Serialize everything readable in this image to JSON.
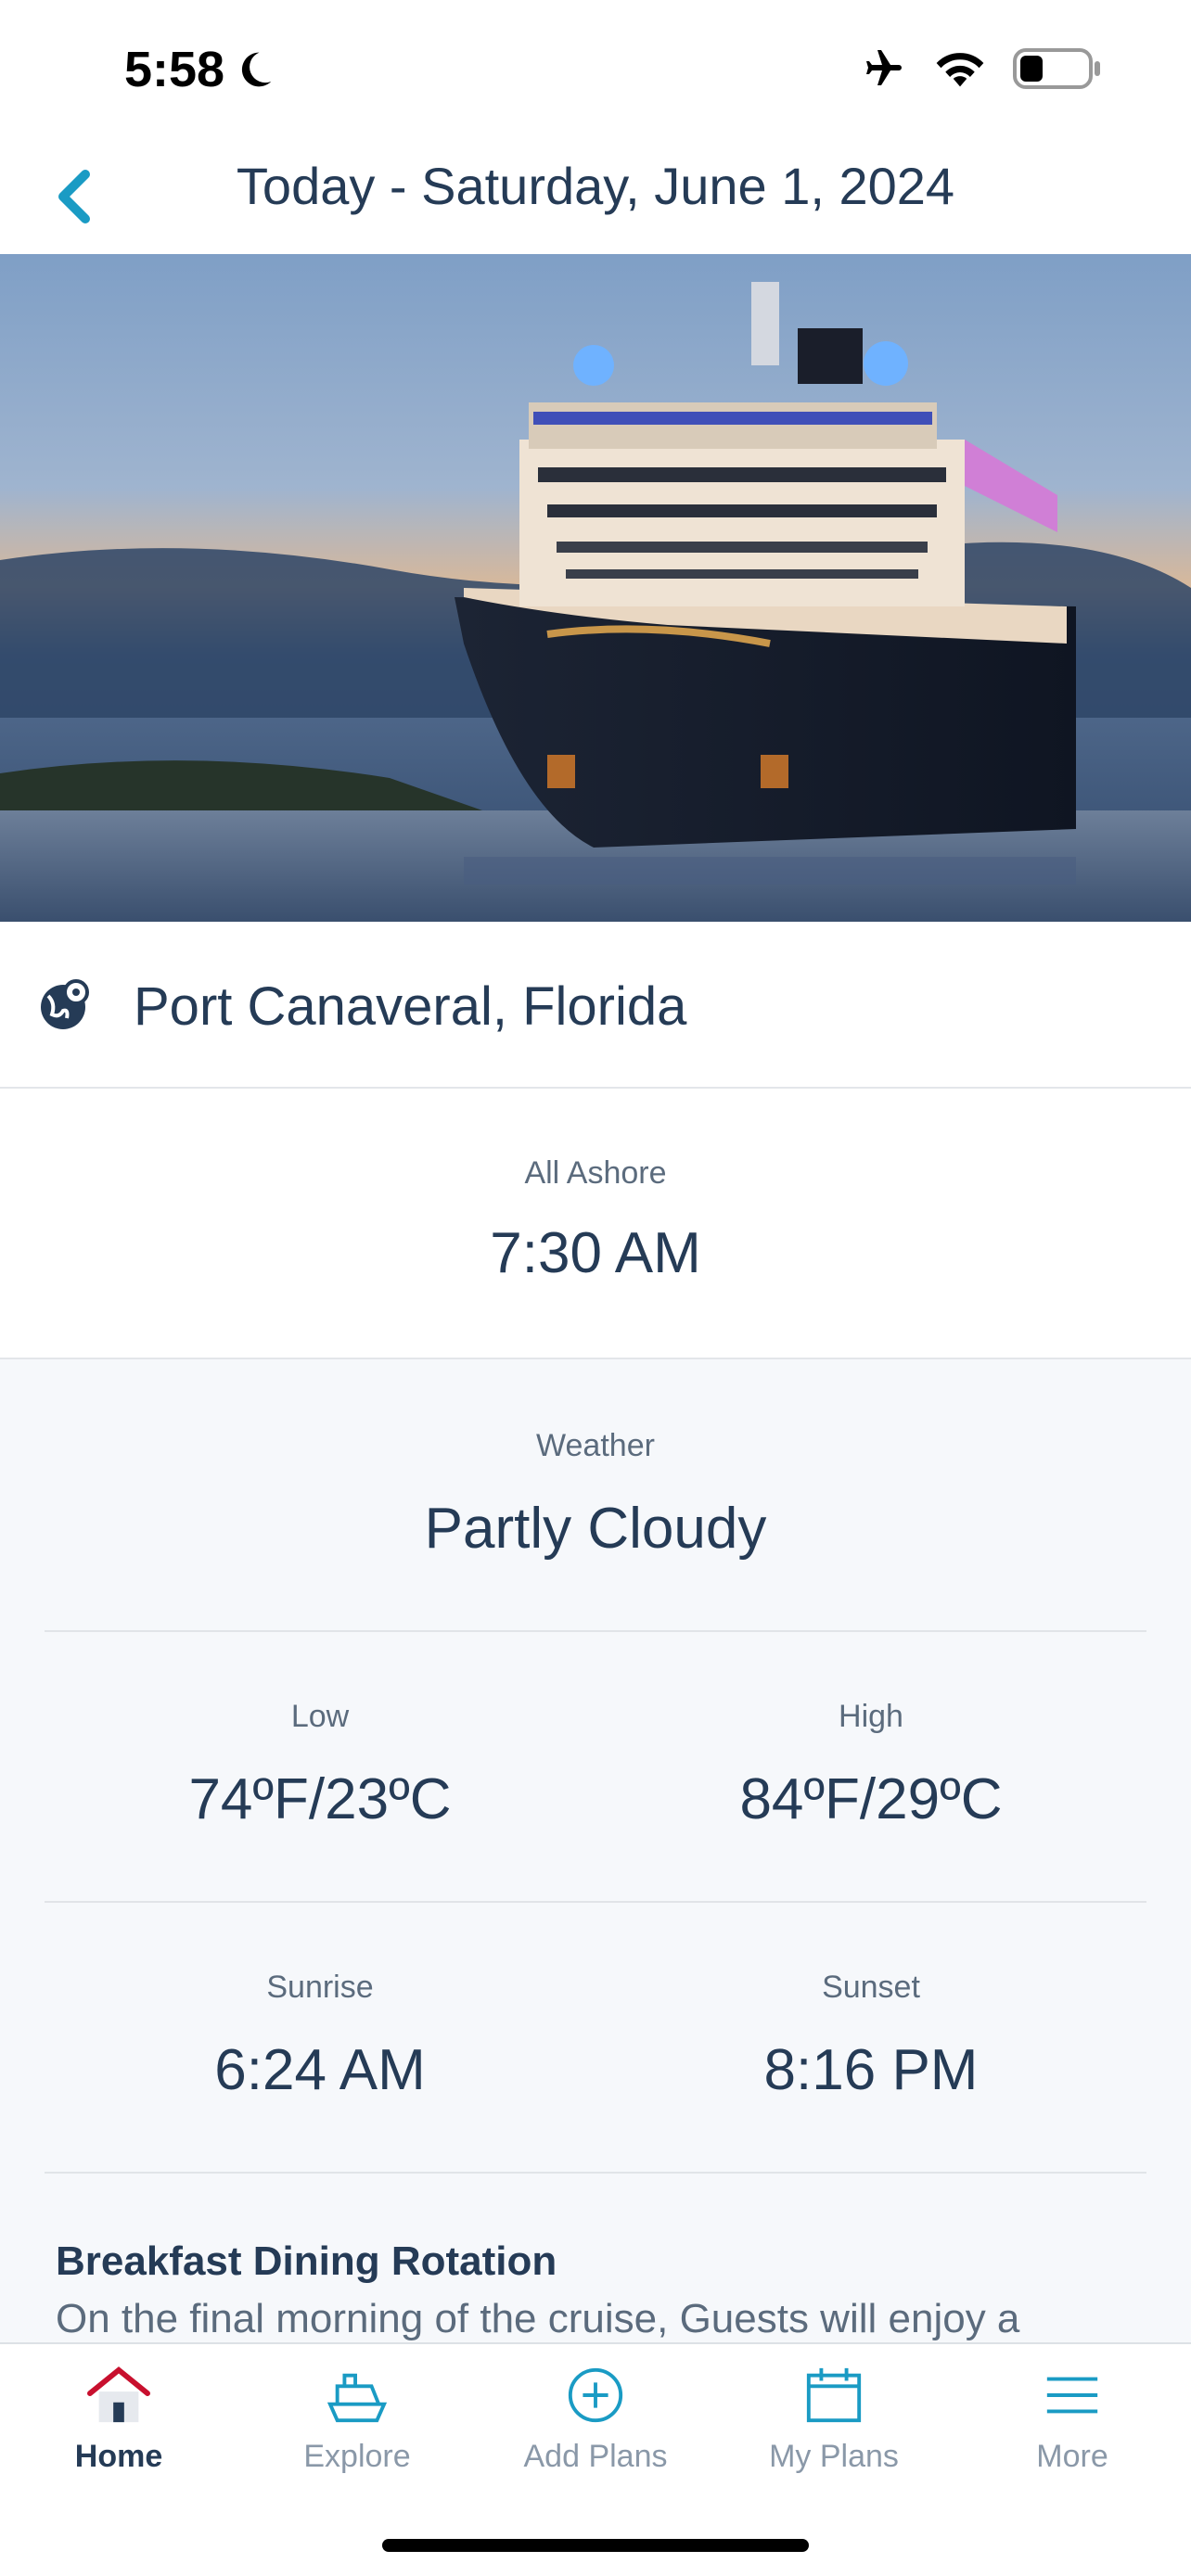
{
  "status_bar": {
    "time": "5:58",
    "icons": [
      "moon-icon",
      "airplane-icon",
      "wifi-icon",
      "battery-icon"
    ]
  },
  "nav": {
    "title": "Today - Saturday, June 1, 2024",
    "back_icon": "chevron-left-icon"
  },
  "hero": {
    "image": "cruise-ship-photo"
  },
  "port": {
    "icon": "globe-pin-icon",
    "name": "Port Canaveral, Florida"
  },
  "ashore": {
    "label": "All Ashore",
    "time": "7:30 AM"
  },
  "weather": {
    "label": "Weather",
    "value": "Partly Cloudy",
    "low_label": "Low",
    "low_value": "74ºF/23ºC",
    "high_label": "High",
    "high_value": "84ºF/29ºC",
    "sunrise_label": "Sunrise",
    "sunrise_value": "6:24 AM",
    "sunset_label": "Sunset",
    "sunset_value": "8:16 PM"
  },
  "dining": {
    "title": "Breakfast Dining Rotation",
    "text": "On the final morning of the cruise, Guests will enjoy a"
  },
  "tabs": [
    {
      "label": "Home",
      "icon": "home-icon",
      "active": true
    },
    {
      "label": "Explore",
      "icon": "ship-icon",
      "active": false
    },
    {
      "label": "Add Plans",
      "icon": "plus-circle-icon",
      "active": false
    },
    {
      "label": "My Plans",
      "icon": "calendar-icon",
      "active": false
    },
    {
      "label": "More",
      "icon": "menu-icon",
      "active": false
    }
  ],
  "colors": {
    "accent": "#1a9bc4",
    "text_primary": "#253b56",
    "text_secondary": "#5b6b7d",
    "tab_inactive": "#8a98a8",
    "home_red": "#c8102e"
  }
}
